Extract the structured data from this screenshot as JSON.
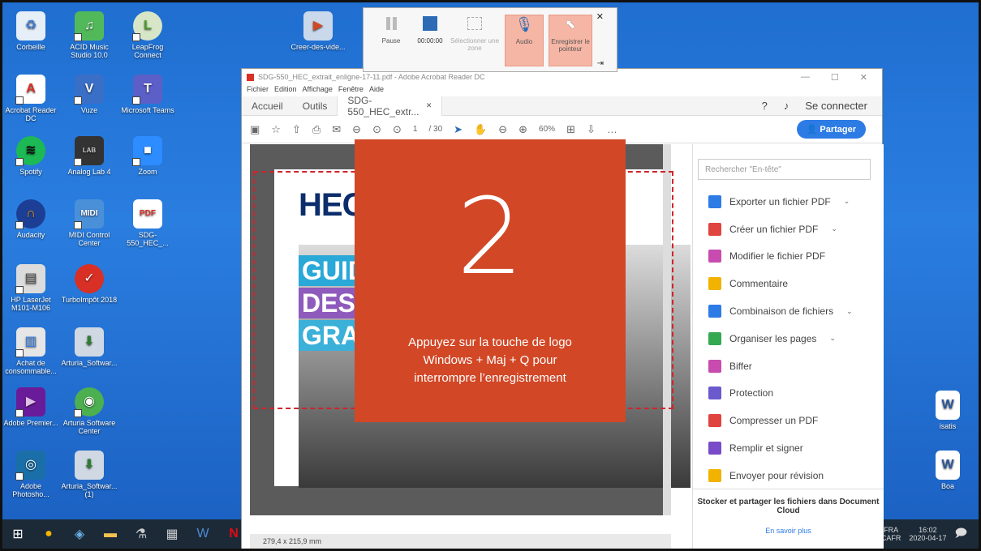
{
  "desktop_icons": [
    {
      "label": "Corbeille"
    },
    {
      "label": "ACID Music Studio 10.0"
    },
    {
      "label": "LeapFrog Connect"
    },
    {
      "label": "Creer-des-vide..."
    },
    {
      "label": "Acrobat Reader DC"
    },
    {
      "label": "Vuze"
    },
    {
      "label": "Microsoft Teams"
    },
    {
      "label": "Spotify"
    },
    {
      "label": "Analog Lab 4"
    },
    {
      "label": "Zoom"
    },
    {
      "label": "Audacity"
    },
    {
      "label": "MIDI Control Center"
    },
    {
      "label": "SDG-550_HEC_..."
    },
    {
      "label": "HP LaserJet M101-M106"
    },
    {
      "label": "TurboImpôt 2018"
    },
    {
      "label": "Achat de consommable..."
    },
    {
      "label": "Arturia_Softwar..."
    },
    {
      "label": "Adobe Premier..."
    },
    {
      "label": "Arturia Software Center"
    },
    {
      "label": "Adobe Photosho..."
    },
    {
      "label": "Arturia_Softwar... (1)"
    },
    {
      "label": "isatis"
    },
    {
      "label": "Boa"
    }
  ],
  "recorder": {
    "pause": "Pause",
    "time": "00:00:00",
    "select_zone": "Sélectionner une zone",
    "audio": "Audio",
    "record_pointer": "Enregistrer le pointeur"
  },
  "acrobat": {
    "title": "SDG-550_HEC_extrait_enligne-17-11.pdf - Adobe Acrobat Reader DC",
    "menu": [
      "Fichier",
      "Edition",
      "Affichage",
      "Fenêtre",
      "Aide"
    ],
    "tabs": {
      "home": "Accueil",
      "tools": "Outils",
      "doc": "SDG-550_HEC_extr..."
    },
    "sign_in": "Se connecter",
    "page_num": "1",
    "page_total": "/ 30",
    "zoom": "60%",
    "share": "Partager",
    "search_placeholder": "Rechercher \"En-tête\"",
    "tools": [
      {
        "label": "Exporter un fichier PDF",
        "chev": "⌄",
        "color": "#2d7be5"
      },
      {
        "label": "Créer un fichier PDF",
        "chev": "⌄",
        "color": "#e0443e"
      },
      {
        "label": "Modifier le fichier PDF",
        "chev": "",
        "color": "#c84bb0"
      },
      {
        "label": "Commentaire",
        "chev": "",
        "color": "#f2b200"
      },
      {
        "label": "Combinaison de fichiers",
        "chev": "⌄",
        "color": "#2d7be5"
      },
      {
        "label": "Organiser les pages",
        "chev": "⌄",
        "color": "#35a852"
      },
      {
        "label": "Biffer",
        "chev": "",
        "color": "#c84bb0"
      },
      {
        "label": "Protection",
        "chev": "",
        "color": "#6a5acd"
      },
      {
        "label": "Compresser un PDF",
        "chev": "",
        "color": "#e0443e"
      },
      {
        "label": "Remplir et signer",
        "chev": "",
        "color": "#7a4bc8"
      },
      {
        "label": "Envoyer pour révision",
        "chev": "",
        "color": "#f2b200"
      }
    ],
    "cloud_text": "Stocker et partager les fichiers dans Document Cloud",
    "cloud_more": "En savoir plus",
    "page_size": "279,4 x 215,9 mm",
    "doc_hec": "HEC",
    "doc_bands": [
      "GUIDE",
      "DES NO",
      "GRAPHI"
    ]
  },
  "countdown": {
    "number": "2",
    "message": "Appuyez sur la touche de logo Windows + Maj + Q pour interrompre l’enregistrement"
  },
  "taskbar": {
    "lang": "FRA",
    "lang2": "CAFR",
    "time": "16:02",
    "date": "2020-04-17"
  }
}
